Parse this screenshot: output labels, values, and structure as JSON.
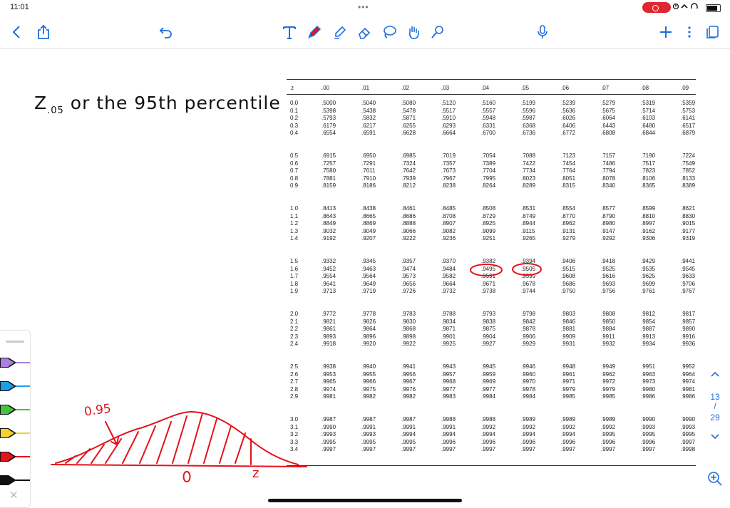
{
  "status": {
    "time": "11:01",
    "dots": "•••"
  },
  "toolbar": {
    "left": [
      "back-icon",
      "share-icon",
      "undo-icon"
    ],
    "tools": [
      "text-tool-icon",
      "pen-tool-icon",
      "highlighter-icon",
      "eraser-icon",
      "lasso-icon",
      "hand-tool-icon",
      "laser-pointer-icon"
    ],
    "right": [
      "mic-icon",
      "add-icon",
      "more-icon",
      "pages-icon"
    ],
    "accent": "#1d6fe0"
  },
  "note": {
    "z_main": "Z",
    "z_sub": ".05",
    "rest": " or the 95th percentile",
    "curve_label": "0.95",
    "zero_label": "0",
    "z_label": "z",
    "ink_color": "#e3131b"
  },
  "ztable": {
    "header": [
      "z",
      ".00",
      ".01",
      ".02",
      ".03",
      ".04",
      ".05",
      ".06",
      ".07",
      ".08",
      ".09"
    ],
    "rows": [
      [
        "0.0",
        ".5000",
        ".5040",
        ".5080",
        ".5120",
        ".5160",
        ".5199",
        ".5239",
        ".5279",
        ".5319",
        ".5359"
      ],
      [
        "0.1",
        ".5398",
        ".5438",
        ".5478",
        ".5517",
        ".5557",
        ".5596",
        ".5636",
        ".5675",
        ".5714",
        ".5753"
      ],
      [
        "0.2",
        ".5793",
        ".5832",
        ".5871",
        ".5910",
        ".5948",
        ".5987",
        ".6026",
        ".6064",
        ".6103",
        ".6141"
      ],
      [
        "0.3",
        ".6179",
        ".6217",
        ".6255",
        ".6293",
        ".6331",
        ".6368",
        ".6406",
        ".6443",
        ".6480",
        ".6517"
      ],
      [
        "0.4",
        ".6554",
        ".6591",
        ".6628",
        ".6664",
        ".6700",
        ".6736",
        ".6772",
        ".6808",
        ".6844",
        ".6879"
      ],
      [
        "0.5",
        ".6915",
        ".6950",
        ".6985",
        ".7019",
        ".7054",
        ".7088",
        ".7123",
        ".7157",
        ".7190",
        ".7224"
      ],
      [
        "0.6",
        ".7257",
        ".7291",
        ".7324",
        ".7357",
        ".7389",
        ".7422",
        ".7454",
        ".7486",
        ".7517",
        ".7549"
      ],
      [
        "0.7",
        ".7580",
        ".7611",
        ".7642",
        ".7673",
        ".7704",
        ".7734",
        ".7764",
        ".7794",
        ".7823",
        ".7852"
      ],
      [
        "0.8",
        ".7881",
        ".7910",
        ".7939",
        ".7967",
        ".7995",
        ".8023",
        ".8051",
        ".8078",
        ".8106",
        ".8133"
      ],
      [
        "0.9",
        ".8159",
        ".8186",
        ".8212",
        ".8238",
        ".8264",
        ".8289",
        ".8315",
        ".8340",
        ".8365",
        ".8389"
      ],
      [
        "1.0",
        ".8413",
        ".8438",
        ".8461",
        ".8485",
        ".8508",
        ".8531",
        ".8554",
        ".8577",
        ".8599",
        ".8621"
      ],
      [
        "1.1",
        ".8643",
        ".8665",
        ".8686",
        ".8708",
        ".8729",
        ".8749",
        ".8770",
        ".8790",
        ".8810",
        ".8830"
      ],
      [
        "1.2",
        ".8849",
        ".8869",
        ".8888",
        ".8907",
        ".8925",
        ".8944",
        ".8962",
        ".8980",
        ".8997",
        ".9015"
      ],
      [
        "1.3",
        ".9032",
        ".9049",
        ".9066",
        ".9082",
        ".9099",
        ".9115",
        ".9131",
        ".9147",
        ".9162",
        ".9177"
      ],
      [
        "1.4",
        ".9192",
        ".9207",
        ".9222",
        ".9236",
        ".9251",
        ".9265",
        ".9279",
        ".9292",
        ".9306",
        ".9319"
      ],
      [
        "1.5",
        ".9332",
        ".9345",
        ".9357",
        ".9370",
        ".9382",
        ".9394",
        ".9406",
        ".9418",
        ".9429",
        ".9441"
      ],
      [
        "1.6",
        ".9452",
        ".9463",
        ".9474",
        ".9484",
        ".9495",
        ".9505",
        ".9515",
        ".9525",
        ".9535",
        ".9545"
      ],
      [
        "1.7",
        ".9554",
        ".9564",
        ".9573",
        ".9582",
        ".9591",
        ".9599",
        ".9608",
        ".9616",
        ".9625",
        ".9633"
      ],
      [
        "1.8",
        ".9641",
        ".9649",
        ".9656",
        ".9664",
        ".9671",
        ".9678",
        ".9686",
        ".9693",
        ".9699",
        ".9706"
      ],
      [
        "1.9",
        ".9713",
        ".9719",
        ".9726",
        ".9732",
        ".9738",
        ".9744",
        ".9750",
        ".9756",
        ".9761",
        ".9767"
      ],
      [
        "2.0",
        ".9772",
        ".9778",
        ".9783",
        ".9788",
        ".9793",
        ".9798",
        ".9803",
        ".9808",
        ".9812",
        ".9817"
      ],
      [
        "2.1",
        ".9821",
        ".9826",
        ".9830",
        ".9834",
        ".9838",
        ".9842",
        ".9846",
        ".9850",
        ".9854",
        ".9857"
      ],
      [
        "2.2",
        ".9861",
        ".9864",
        ".9868",
        ".9871",
        ".9875",
        ".9878",
        ".9881",
        ".9884",
        ".9887",
        ".9890"
      ],
      [
        "2.3",
        ".9893",
        ".9896",
        ".9898",
        ".9901",
        ".9904",
        ".9906",
        ".9909",
        ".9911",
        ".9913",
        ".9916"
      ],
      [
        "2.4",
        ".9918",
        ".9920",
        ".9922",
        ".9925",
        ".9927",
        ".9929",
        ".9931",
        ".9932",
        ".9934",
        ".9936"
      ],
      [
        "2.5",
        ".9938",
        ".9940",
        ".9941",
        ".9943",
        ".9945",
        ".9946",
        ".9948",
        ".9949",
        ".9951",
        ".9952"
      ],
      [
        "2.6",
        ".9953",
        ".9955",
        ".9956",
        ".9957",
        ".9959",
        ".9960",
        ".9961",
        ".9962",
        ".9963",
        ".9964"
      ],
      [
        "2.7",
        ".9965",
        ".9966",
        ".9967",
        ".9968",
        ".9969",
        ".9970",
        ".9971",
        ".9972",
        ".9973",
        ".9974"
      ],
      [
        "2.8",
        ".9974",
        ".9975",
        ".9976",
        ".9977",
        ".9977",
        ".9978",
        ".9979",
        ".9979",
        ".9980",
        ".9981"
      ],
      [
        "2.9",
        ".9981",
        ".9982",
        ".9982",
        ".9983",
        ".9984",
        ".9984",
        ".9985",
        ".9985",
        ".9986",
        ".9986"
      ],
      [
        "3.0",
        ".9987",
        ".9987",
        ".9987",
        ".9988",
        ".9988",
        ".9989",
        ".9989",
        ".9989",
        ".9990",
        ".9990"
      ],
      [
        "3.1",
        ".9990",
        ".9991",
        ".9991",
        ".9991",
        ".9992",
        ".9992",
        ".9992",
        ".9992",
        ".9993",
        ".9993"
      ],
      [
        "3.2",
        ".9993",
        ".9993",
        ".9994",
        ".9994",
        ".9994",
        ".9994",
        ".9994",
        ".9995",
        ".9995",
        ".9995"
      ],
      [
        "3.3",
        ".9995",
        ".9995",
        ".9995",
        ".9996",
        ".9996",
        ".9996",
        ".9996",
        ".9996",
        ".9996",
        ".9997"
      ],
      [
        "3.4",
        ".9997",
        ".9997",
        ".9997",
        ".9997",
        ".9997",
        ".9997",
        ".9997",
        ".9997",
        ".9997",
        ".9998"
      ]
    ],
    "circled": [
      ".9495",
      ".9505"
    ]
  },
  "pen_tray": {
    "pens": [
      {
        "name": "purple-pen",
        "color": "#a97fe0"
      },
      {
        "name": "blue-pen",
        "color": "#1aa0e6"
      },
      {
        "name": "green-pen",
        "color": "#43c43a"
      },
      {
        "name": "yellow-pen",
        "color": "#f2d22b"
      },
      {
        "name": "red-pen",
        "color": "#e3131b"
      },
      {
        "name": "black-pen",
        "color": "#111111"
      }
    ],
    "close": "✕"
  },
  "page_nav": {
    "current": "13",
    "separator": "/",
    "total": "29"
  }
}
